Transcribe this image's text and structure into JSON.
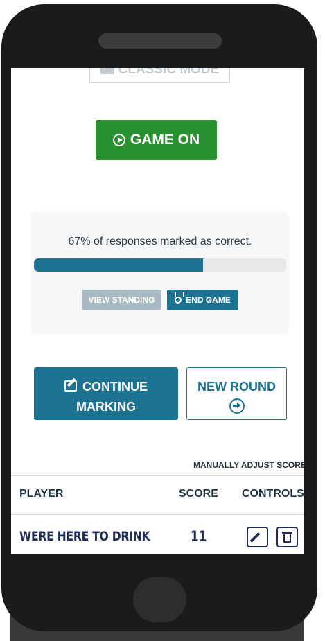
{
  "classic_mode": {
    "label": "CLASSIC MODE",
    "icon": "layers-icon"
  },
  "game_on": {
    "label": "GAME ON",
    "icon": "play-circle-icon",
    "color": "#2a9131"
  },
  "marking": {
    "message": "67% of responses marked as correct.",
    "progress_percent": 67,
    "view_standing_label": "VIEW STANDING",
    "end_game_label": "END GAME",
    "end_game_icon": "medal-icon"
  },
  "actions": {
    "continue_label_line1": "CONTINUE",
    "continue_label_line2": "MARKING",
    "continue_icon": "edit-icon",
    "new_round_label": "NEW ROUND",
    "new_round_icon": "arrow-right-circle-icon"
  },
  "scores": {
    "manual_adjust_label": "MANUALLY ADJUST SCORES",
    "headers": {
      "player": "PLAYER",
      "score": "SCORE",
      "controls": "CONTROLS"
    },
    "rows": [
      {
        "player": "WERE HERE TO DRINK",
        "score": "11",
        "edit_icon": "pencil-icon",
        "delete_icon": "trash-icon"
      }
    ]
  },
  "colors": {
    "accent": "#1c7391",
    "success": "#2a9131",
    "text_dark": "#1f2c57"
  }
}
